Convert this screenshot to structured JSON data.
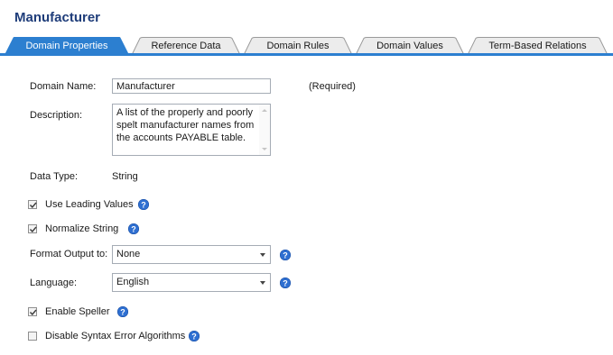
{
  "header": {
    "title": "Manufacturer"
  },
  "tabs": [
    {
      "label": "Domain Properties",
      "active": true
    },
    {
      "label": "Reference Data",
      "active": false
    },
    {
      "label": "Domain Rules",
      "active": false
    },
    {
      "label": "Domain Values",
      "active": false
    },
    {
      "label": "Term-Based Relations",
      "active": false
    }
  ],
  "form": {
    "domain_name": {
      "label": "Domain Name:",
      "value": "Manufacturer",
      "note": "(Required)"
    },
    "description": {
      "label": "Description:",
      "lines": [
        "A list of the properly and poorly",
        "spelt manufacturer names from",
        "the accounts PAYABLE table."
      ]
    },
    "data_type": {
      "label": "Data Type:",
      "value": "String"
    },
    "use_leading_values": {
      "label": "Use Leading Values",
      "checked": true
    },
    "normalize_string": {
      "label": "Normalize String",
      "checked": true
    },
    "format_output": {
      "label": "Format Output to:",
      "value": "None"
    },
    "language": {
      "label": "Language:",
      "value": "English"
    },
    "enable_speller": {
      "label": "Enable Speller",
      "checked": true
    },
    "disable_syntax": {
      "label": "Disable Syntax Error Algorithms",
      "checked": false
    }
  },
  "colors": {
    "accent": "#2c7fd0",
    "title": "#1f3d7a",
    "help_icon": "#2e6fd1"
  },
  "icons": {
    "help": "help-icon",
    "check": "check-icon"
  }
}
